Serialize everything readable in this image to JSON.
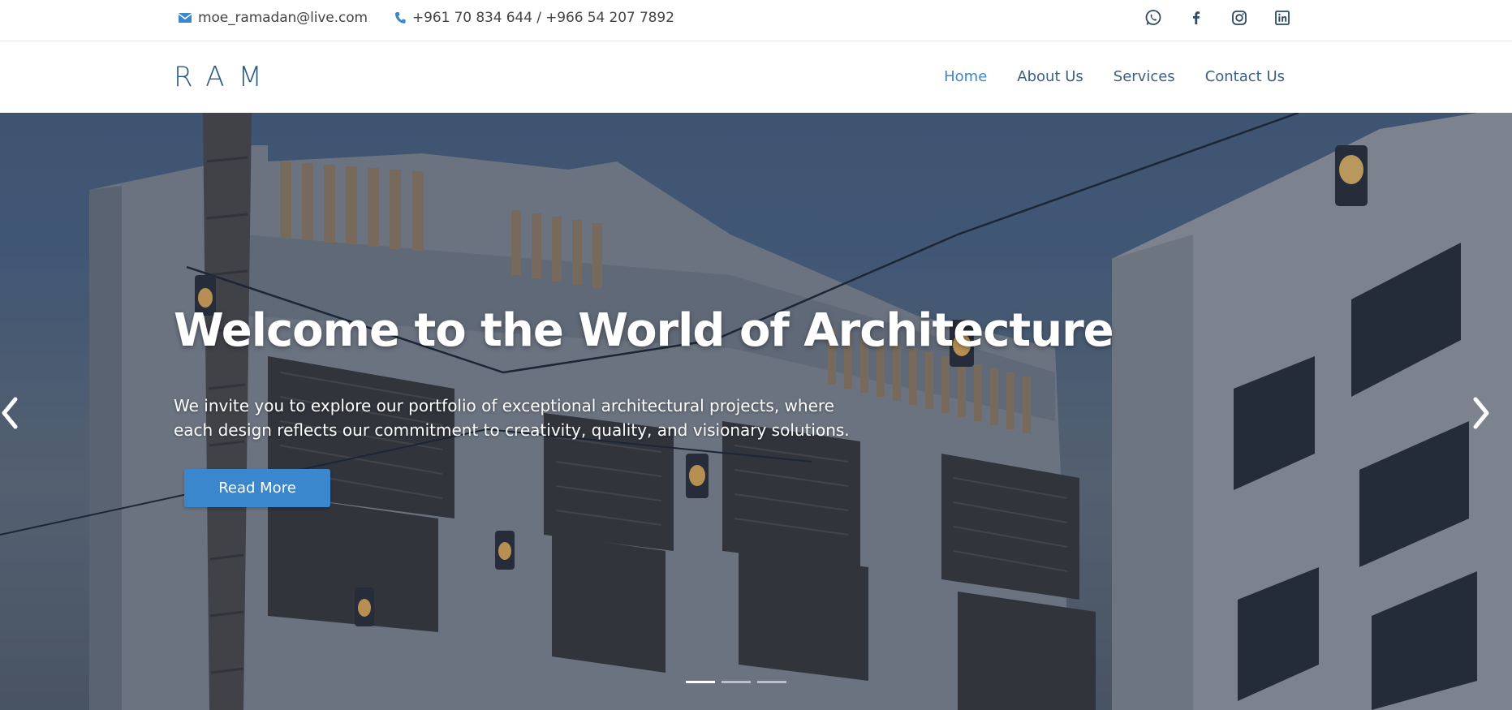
{
  "topbar": {
    "email": "moe_ramadan@live.com",
    "phone": "+961 70 834 644 / +966 54 207 7892",
    "icons": [
      "mail-icon",
      "phone-icon",
      "whatsapp-icon",
      "facebook-icon",
      "instagram-icon",
      "linkedin-icon"
    ]
  },
  "header": {
    "logo": "RAM",
    "nav": [
      {
        "label": "Home",
        "active": true
      },
      {
        "label": "About Us",
        "active": false
      },
      {
        "label": "Services",
        "active": false
      },
      {
        "label": "Contact Us",
        "active": false
      }
    ]
  },
  "hero": {
    "title": "Welcome to the World of Architecture",
    "description": "We invite you to explore our portfolio of exceptional architectural projects, where each design reflects our commitment to creativity, quality, and visionary solutions.",
    "button": "Read More",
    "slide_count": 3,
    "active_slide": 1
  },
  "colors": {
    "accent": "#3a87cd",
    "logo": "#2c5a85",
    "nav_text": "#3b5f82",
    "nav_active": "#3f86c6"
  }
}
